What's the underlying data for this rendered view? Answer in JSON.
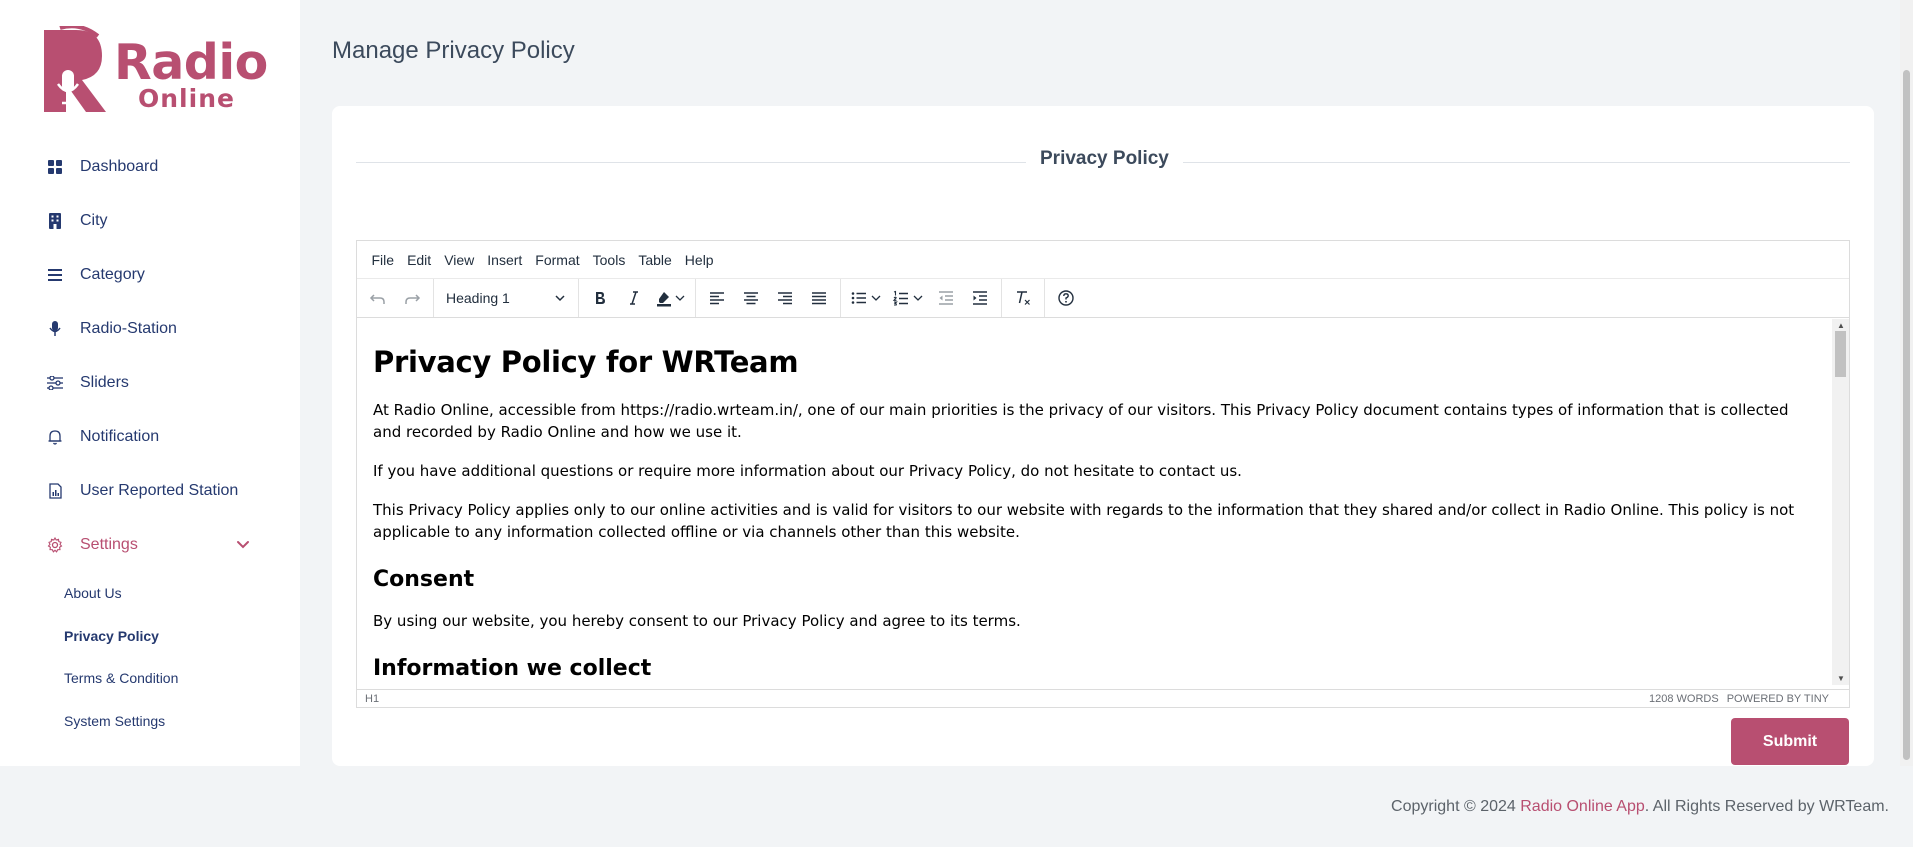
{
  "brand": {
    "line1": "Radio",
    "line2": "Online",
    "color": "#b84f71"
  },
  "sidebar": {
    "items": [
      {
        "label": "Dashboard",
        "icon": "grid-icon"
      },
      {
        "label": "City",
        "icon": "building-icon"
      },
      {
        "label": "Category",
        "icon": "list-icon"
      },
      {
        "label": "Radio-Station",
        "icon": "microphone-icon"
      },
      {
        "label": "Sliders",
        "icon": "sliders-icon"
      },
      {
        "label": "Notification",
        "icon": "bell-icon"
      },
      {
        "label": "User Reported Station",
        "icon": "report-icon"
      },
      {
        "label": "Settings",
        "icon": "gear-icon"
      }
    ],
    "settings_sub": [
      "About Us",
      "Privacy Policy",
      "Terms & Condition",
      "System Settings"
    ]
  },
  "header": {
    "title": "Manage Privacy Policy"
  },
  "card": {
    "heading": "Privacy Policy"
  },
  "editor": {
    "menubar": [
      "File",
      "Edit",
      "View",
      "Insert",
      "Format",
      "Tools",
      "Table",
      "Help"
    ],
    "block_format": "Heading 1",
    "content": {
      "h1": "Privacy Policy for WRTeam",
      "p1": "At Radio Online, accessible from https://radio.wrteam.in/, one of our main priorities is the privacy of our visitors. This Privacy Policy document contains types of information that is collected and recorded by Radio Online and how we use it.",
      "p2": "If you have additional questions or require more information about our Privacy Policy, do not hesitate to contact us.",
      "p3": "This Privacy Policy applies only to our online activities and is valid for visitors to our website with regards to the information that they shared and/or collect in Radio Online. This policy is not applicable to any information collected offline or via channels other than this website.",
      "h2a": "Consent",
      "p4": "By using our website, you hereby consent to our Privacy Policy and agree to its terms.",
      "h2b": "Information we collect"
    },
    "status_path": "H1",
    "word_count": "1208 WORDS",
    "powered_by": "POWERED BY TINY"
  },
  "submit_label": "Submit",
  "footer": {
    "prefix": "Copyright © 2024 ",
    "brand": "Radio Online App",
    "suffix": ". All Rights Reserved by WRTeam."
  }
}
